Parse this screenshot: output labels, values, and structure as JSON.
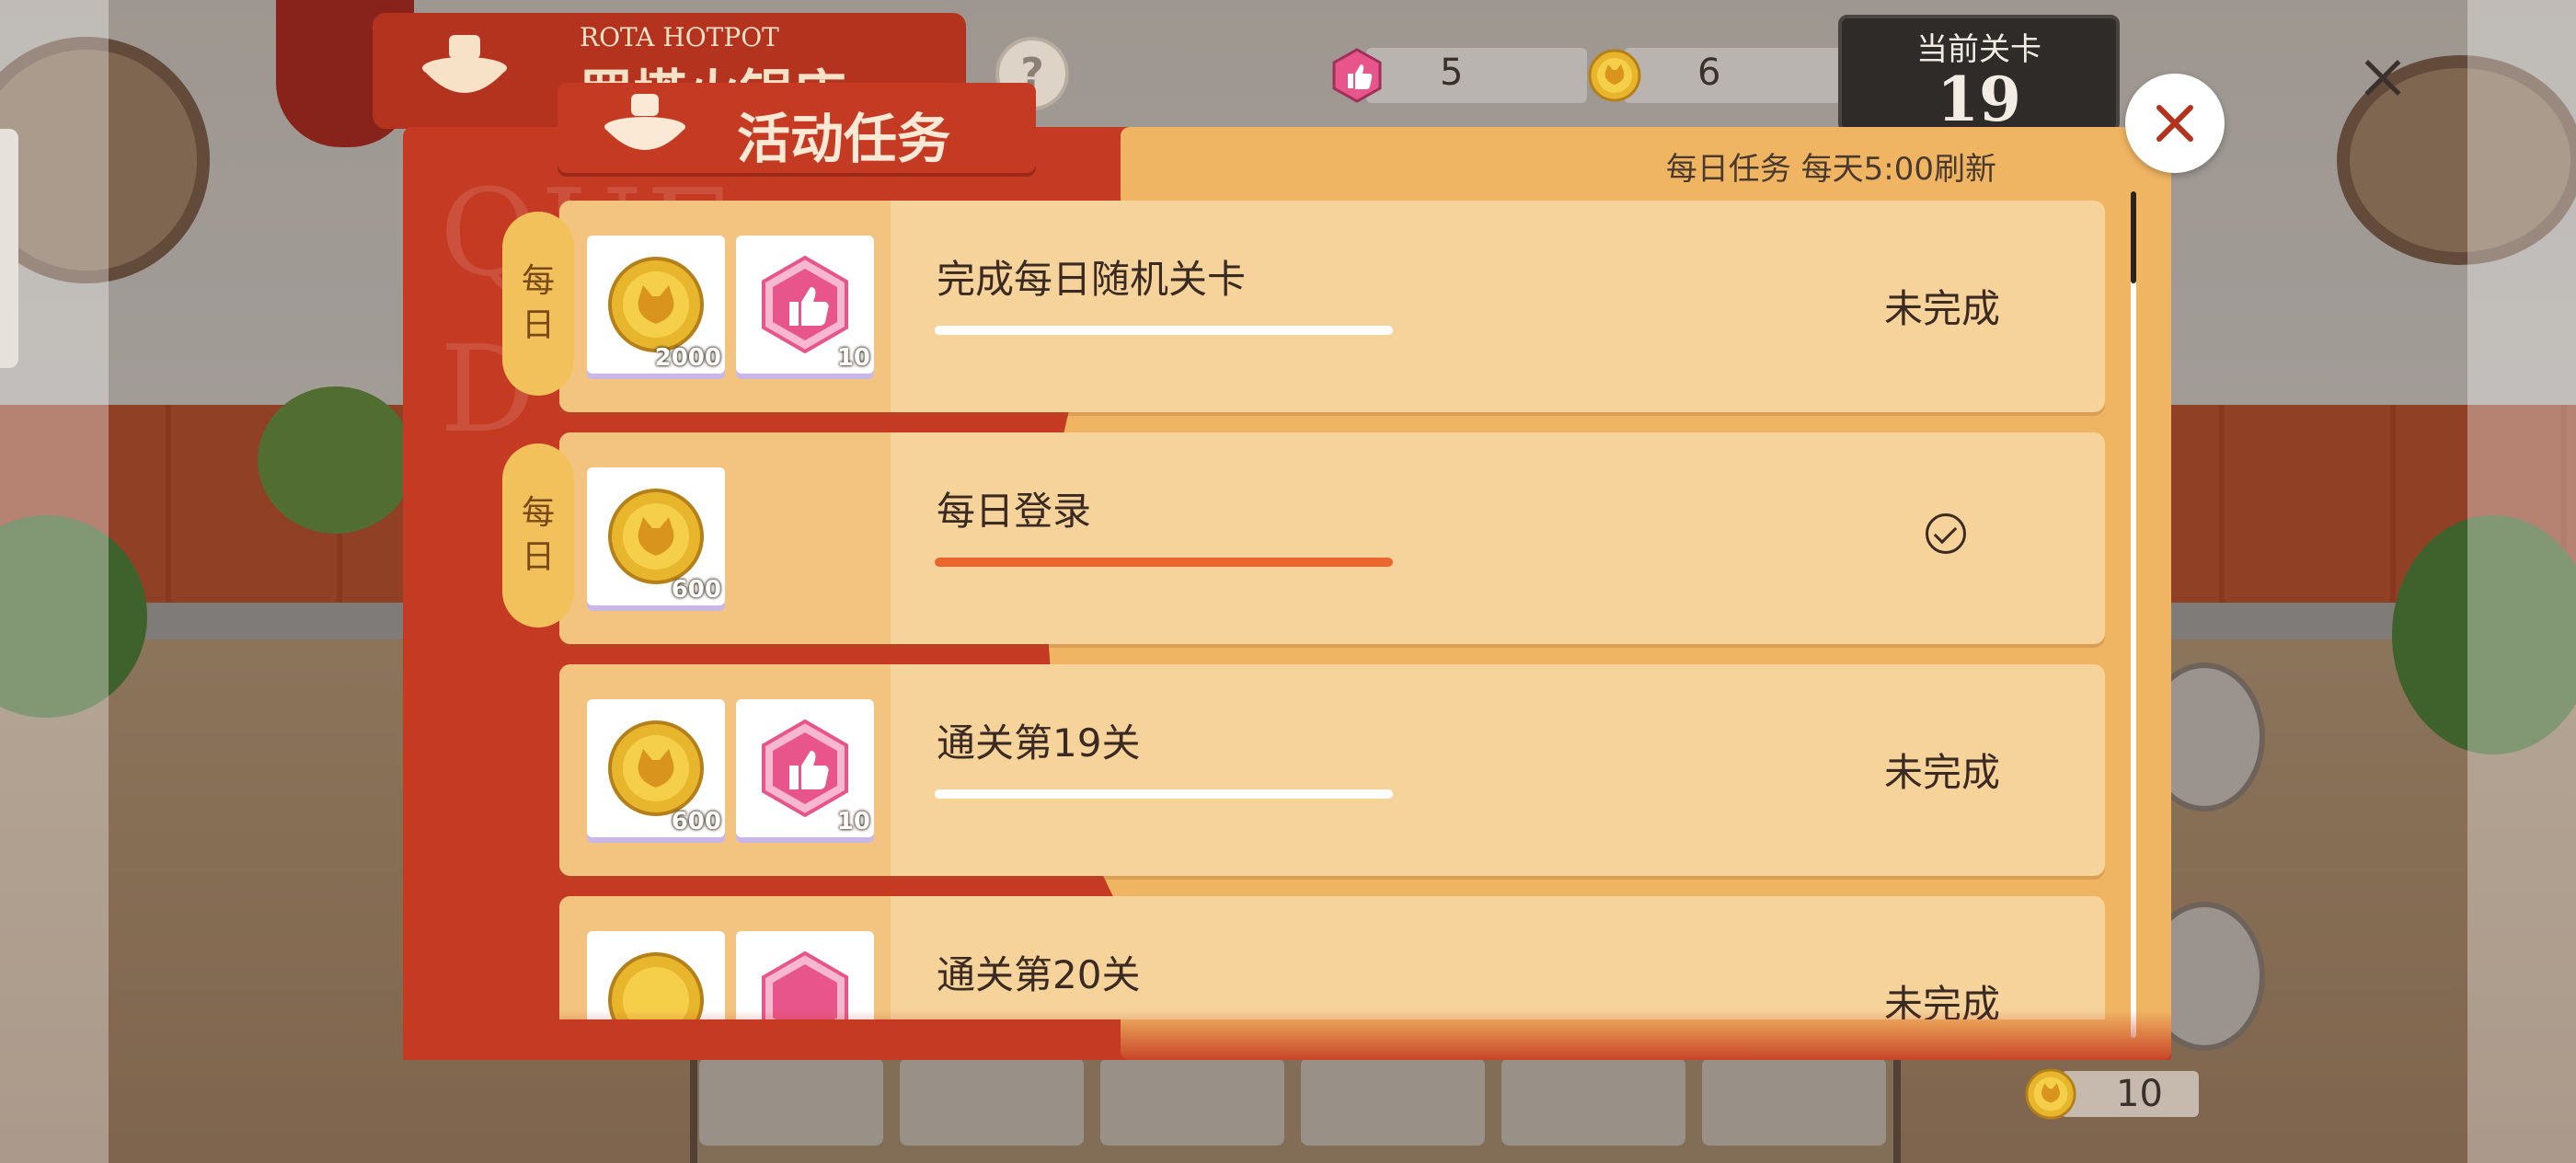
{
  "hud": {
    "restaurant_en": "ROTA HOTPOT",
    "restaurant_cn": "罗塔火锅店",
    "help_label": "?",
    "likes": "5",
    "coins": "6",
    "level_label": "当前关卡",
    "level_number": "19",
    "bottom_coins": "10"
  },
  "modal": {
    "title": "活动任务",
    "watermark_lines": [
      "QUE",
      "D"
    ],
    "refresh_note": "每日任务 每天5:00刷新",
    "tasks": [
      {
        "badge": [
          "每",
          "日"
        ],
        "rewards": [
          {
            "icon": "coin-icon",
            "amount": "2000"
          },
          {
            "icon": "like-icon",
            "amount": "10"
          }
        ],
        "name": "完成每日随机关卡",
        "progress": 0,
        "status": "未完成",
        "completed": false
      },
      {
        "badge": [
          "每",
          "日"
        ],
        "rewards": [
          {
            "icon": "coin-icon",
            "amount": "600"
          }
        ],
        "name": "每日登录",
        "progress": 1,
        "status": "",
        "completed": true
      },
      {
        "badge": [],
        "rewards": [
          {
            "icon": "coin-icon",
            "amount": "600"
          },
          {
            "icon": "like-icon",
            "amount": "10"
          }
        ],
        "name": "通关第19关",
        "progress": 0,
        "status": "未完成",
        "completed": false
      },
      {
        "badge": [],
        "rewards": [
          {
            "icon": "coin-icon",
            "amount": ""
          },
          {
            "icon": "like-icon",
            "amount": ""
          }
        ],
        "name": "通关第20关",
        "progress": 0,
        "status": "未完成",
        "completed": false
      }
    ]
  },
  "colors": {
    "modal_red": "#c43a22",
    "modal_tan": "#f0b563",
    "card": "#f6d39b",
    "progress_fill": "#e9672c",
    "badge": "#f3c15c",
    "like_pink": "#e8558a",
    "coin_gold": "#e8b62c"
  }
}
